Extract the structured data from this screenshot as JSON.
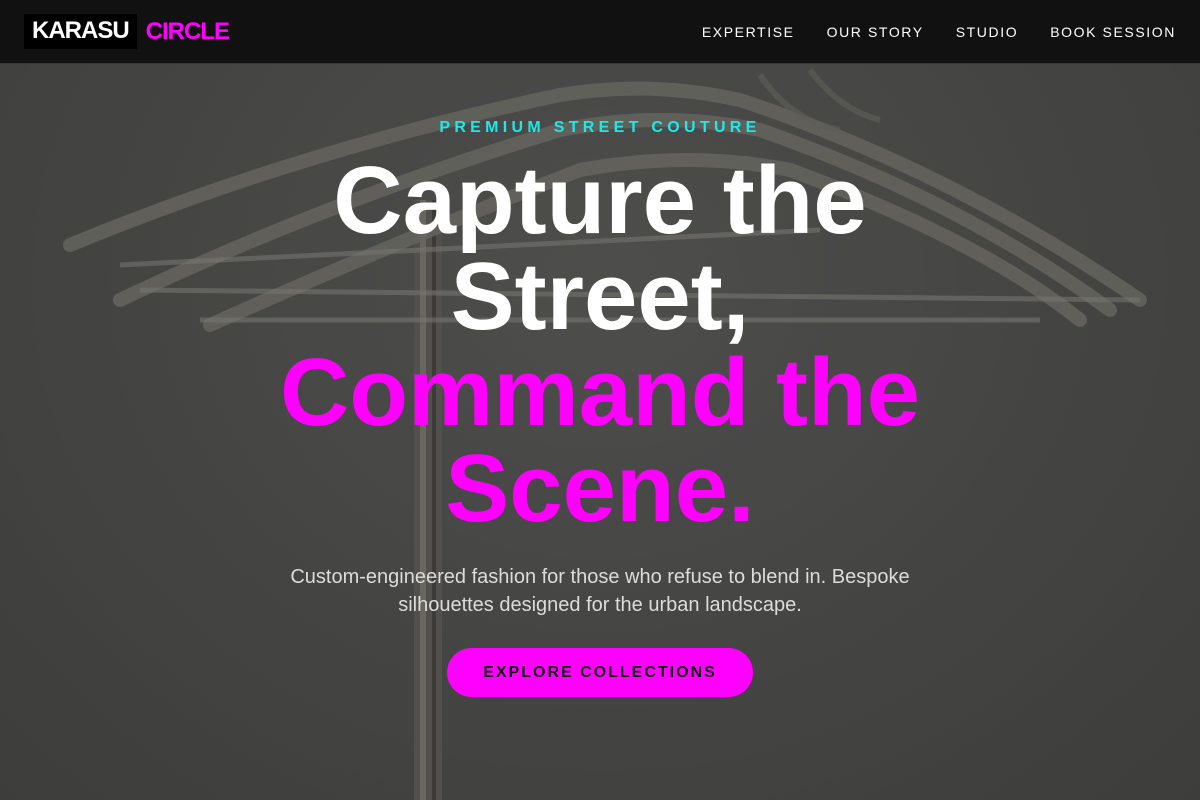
{
  "brand": {
    "name_part1": "KARASU",
    "name_part2": "CIRCLE",
    "accent_color": "#ff00ff"
  },
  "nav": {
    "items": [
      {
        "label": "EXPERTISE"
      },
      {
        "label": "OUR STORY"
      },
      {
        "label": "STUDIO"
      },
      {
        "label": "BOOK SESSION"
      }
    ]
  },
  "hero": {
    "eyebrow": "PREMIUM STREET COUTURE",
    "eyebrow_color": "#1fe8e8",
    "headline_white_1": "Capture the",
    "headline_white_2": "Street,",
    "headline_magenta_1": "Command the",
    "headline_magenta_2": "Scene.",
    "description": "Custom-engineered fashion for those who refuse to blend in. Bespoke silhouettes designed for the urban landscape.",
    "cta_label": "EXPLORE COLLECTIONS"
  }
}
